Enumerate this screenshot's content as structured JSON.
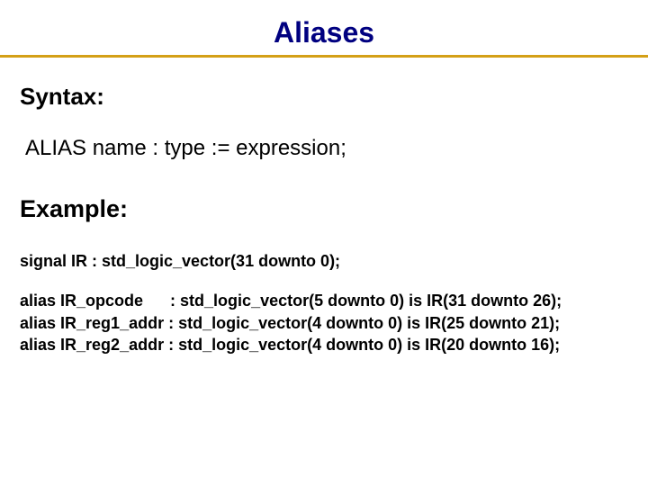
{
  "title": "Aliases",
  "syntax": {
    "heading": "Syntax:",
    "line": "ALIAS   name : type := expression;"
  },
  "example": {
    "heading": "Example:",
    "lines": [
      "signal IR : std_logic_vector(31 downto 0);",
      "",
      "alias IR_opcode      : std_logic_vector(5 downto 0) is IR(31 downto 26);",
      "alias IR_reg1_addr : std_logic_vector(4 downto 0) is IR(25 downto 21);",
      "alias IR_reg2_addr : std_logic_vector(4 downto 0) is IR(20 downto 16);"
    ]
  }
}
